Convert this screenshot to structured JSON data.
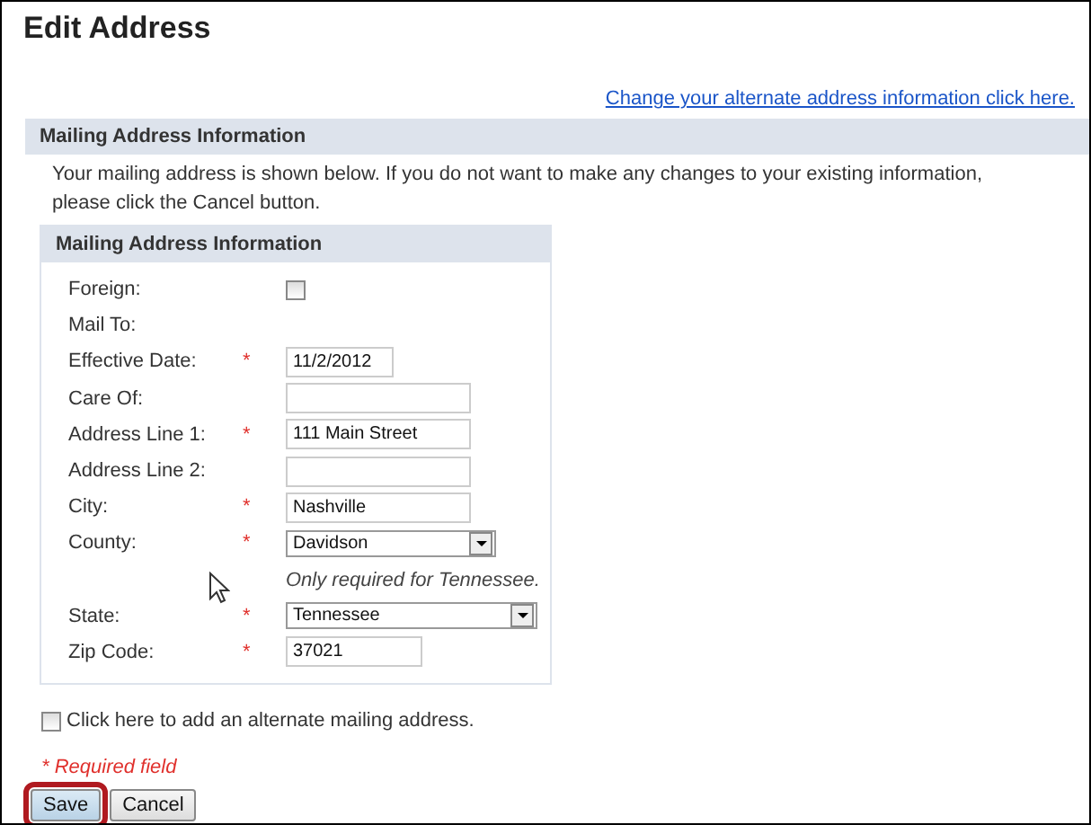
{
  "page": {
    "title": "Edit Address",
    "link": "Change your alternate address information click here."
  },
  "section": {
    "title": "Mailing Address Information",
    "intro": "Your mailing address is shown below. If you do not want to make any changes to your existing information, please click the Cancel button."
  },
  "panel": {
    "title": "Mailing Address Information",
    "fields": [
      {
        "kind": "checkbox",
        "label": "Foreign:",
        "required": false,
        "checked": false
      },
      {
        "kind": "label",
        "label": "Mail To:",
        "required": false
      },
      {
        "kind": "date",
        "label": "Effective Date:",
        "required": true,
        "value": "11/2/2012"
      },
      {
        "kind": "text",
        "label": "Care Of:",
        "required": false
      },
      {
        "kind": "text",
        "label": "Address Line 1:",
        "required": true,
        "value": "111 Main Street"
      },
      {
        "kind": "text",
        "label": "Address Line 2:",
        "required": false
      },
      {
        "kind": "text",
        "label": "City:",
        "required": true,
        "value": "Nashville"
      },
      {
        "kind": "select",
        "label": "County:",
        "required": true,
        "value": "Davidson"
      },
      {
        "kind": "note",
        "text": "Only required for Tennessee."
      },
      {
        "kind": "select",
        "label": "State:",
        "required": true,
        "value": "Tennessee"
      },
      {
        "kind": "zip",
        "label": "Zip Code:",
        "required": true,
        "value": "37021"
      }
    ]
  },
  "alternate": {
    "label": "Click here to add an alternate mailing address.",
    "checked": false
  },
  "required_note": "* Required field",
  "required_mark": "*",
  "buttons": [
    {
      "label": "Save",
      "highlighted": true
    },
    {
      "label": "Cancel",
      "highlighted": false
    }
  ]
}
